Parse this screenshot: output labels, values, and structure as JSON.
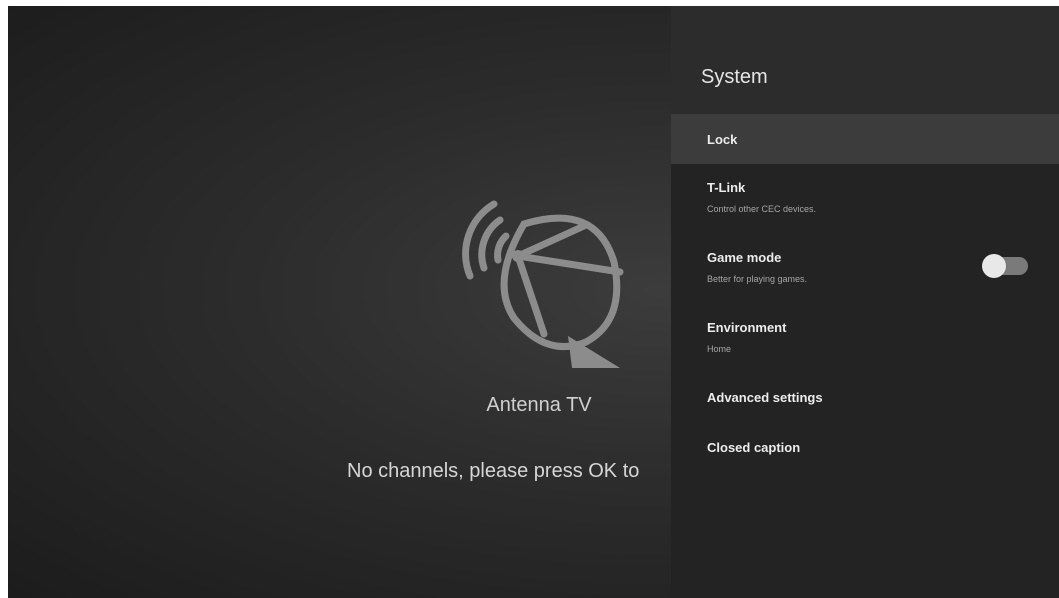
{
  "tv": {
    "source_title": "Antenna TV",
    "message": "No channels, please press OK to",
    "icon": "satellite-dish-icon"
  },
  "panel": {
    "title": "System",
    "items": [
      {
        "label": "Lock",
        "subtitle": "",
        "focused": true
      },
      {
        "label": "T-Link",
        "subtitle": "Control other CEC devices."
      },
      {
        "label": "Game mode",
        "subtitle": "Better for playing games.",
        "toggle": false
      },
      {
        "label": "Environment",
        "subtitle": "Home"
      },
      {
        "label": "Advanced settings",
        "subtitle": ""
      },
      {
        "label": "Closed caption",
        "subtitle": ""
      }
    ]
  },
  "colors": {
    "panel_background": "#232323",
    "focused_item": "#3c3c3c",
    "toggle_off_track": "#7a7a7a"
  }
}
